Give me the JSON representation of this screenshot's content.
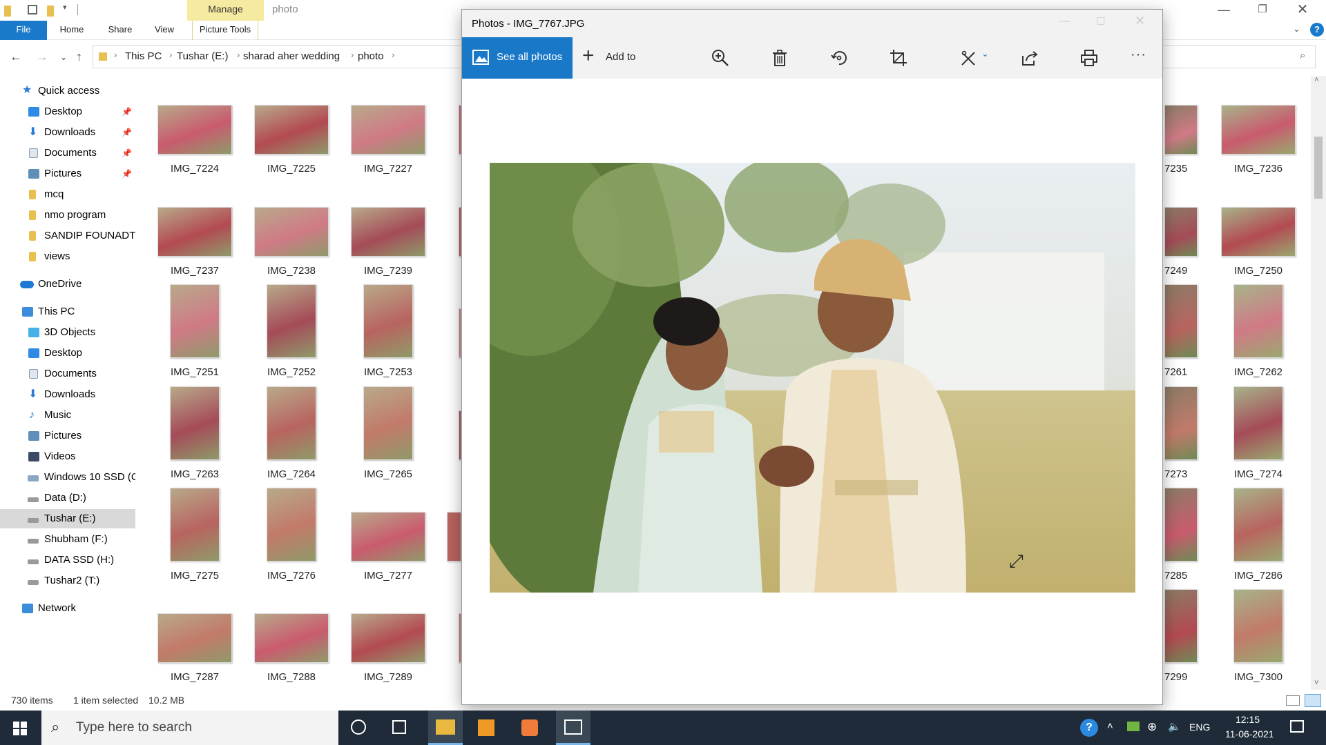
{
  "explorer": {
    "title": "photo",
    "contextual_tab": "Manage",
    "ribbon_tabs": [
      "File",
      "Home",
      "Share",
      "View",
      "Picture Tools"
    ],
    "breadcrumb": [
      "This PC",
      "Tushar (E:)",
      "sharad aher wedding",
      "photo"
    ],
    "help_label": "?",
    "nav": {
      "quick_access": "Quick access",
      "quick_items": [
        "Desktop",
        "Downloads",
        "Documents",
        "Pictures",
        "mcq",
        "nmo program",
        "SANDIP FOUNADTI(",
        "views"
      ],
      "onedrive": "OneDrive",
      "this_pc": "This PC",
      "pc_items": [
        "3D Objects",
        "Desktop",
        "Documents",
        "Downloads",
        "Music",
        "Pictures",
        "Videos",
        "Windows 10 SSD (C",
        "Data (D:)",
        "Tushar (E:)",
        "Shubham (F:)",
        "DATA SSD (H:)",
        "Tushar2 (T:)"
      ],
      "network": "Network"
    },
    "files_left": [
      [
        "IMG_7224",
        "IMG_7225",
        "IMG_7227"
      ],
      [
        "IMG_7237",
        "IMG_7238",
        "IMG_7239"
      ],
      [
        "IMG_7251",
        "IMG_7252",
        "IMG_7253"
      ],
      [
        "IMG_7263",
        "IMG_7264",
        "IMG_7265"
      ],
      [
        "IMG_7275",
        "IMG_7276",
        "IMG_7277"
      ],
      [
        "IMG_7287",
        "IMG_7288",
        "IMG_7289"
      ]
    ],
    "files_right_partial": [
      "7235",
      "7249",
      "7261",
      "7273",
      "7285",
      "7299"
    ],
    "files_right": [
      "IMG_7236",
      "IMG_7250",
      "IMG_7262",
      "IMG_7274",
      "IMG_7286",
      "IMG_7300"
    ],
    "status": {
      "items": "730 items",
      "selected": "1 item selected",
      "size": "10.2 MB"
    }
  },
  "photos": {
    "title": "Photos - IMG_7767.JPG",
    "see_all": "See all photos",
    "add_to": "Add to",
    "toolbar_icons": [
      "zoom-in-icon",
      "delete-icon",
      "rotate-icon",
      "crop-icon",
      "edit-icon",
      "share-icon",
      "print-icon",
      "more-icon"
    ],
    "more_label": "···"
  },
  "taskbar": {
    "search_placeholder": "Type here to search",
    "language": "ENG",
    "time": "12:15",
    "date": "11-06-2021"
  }
}
